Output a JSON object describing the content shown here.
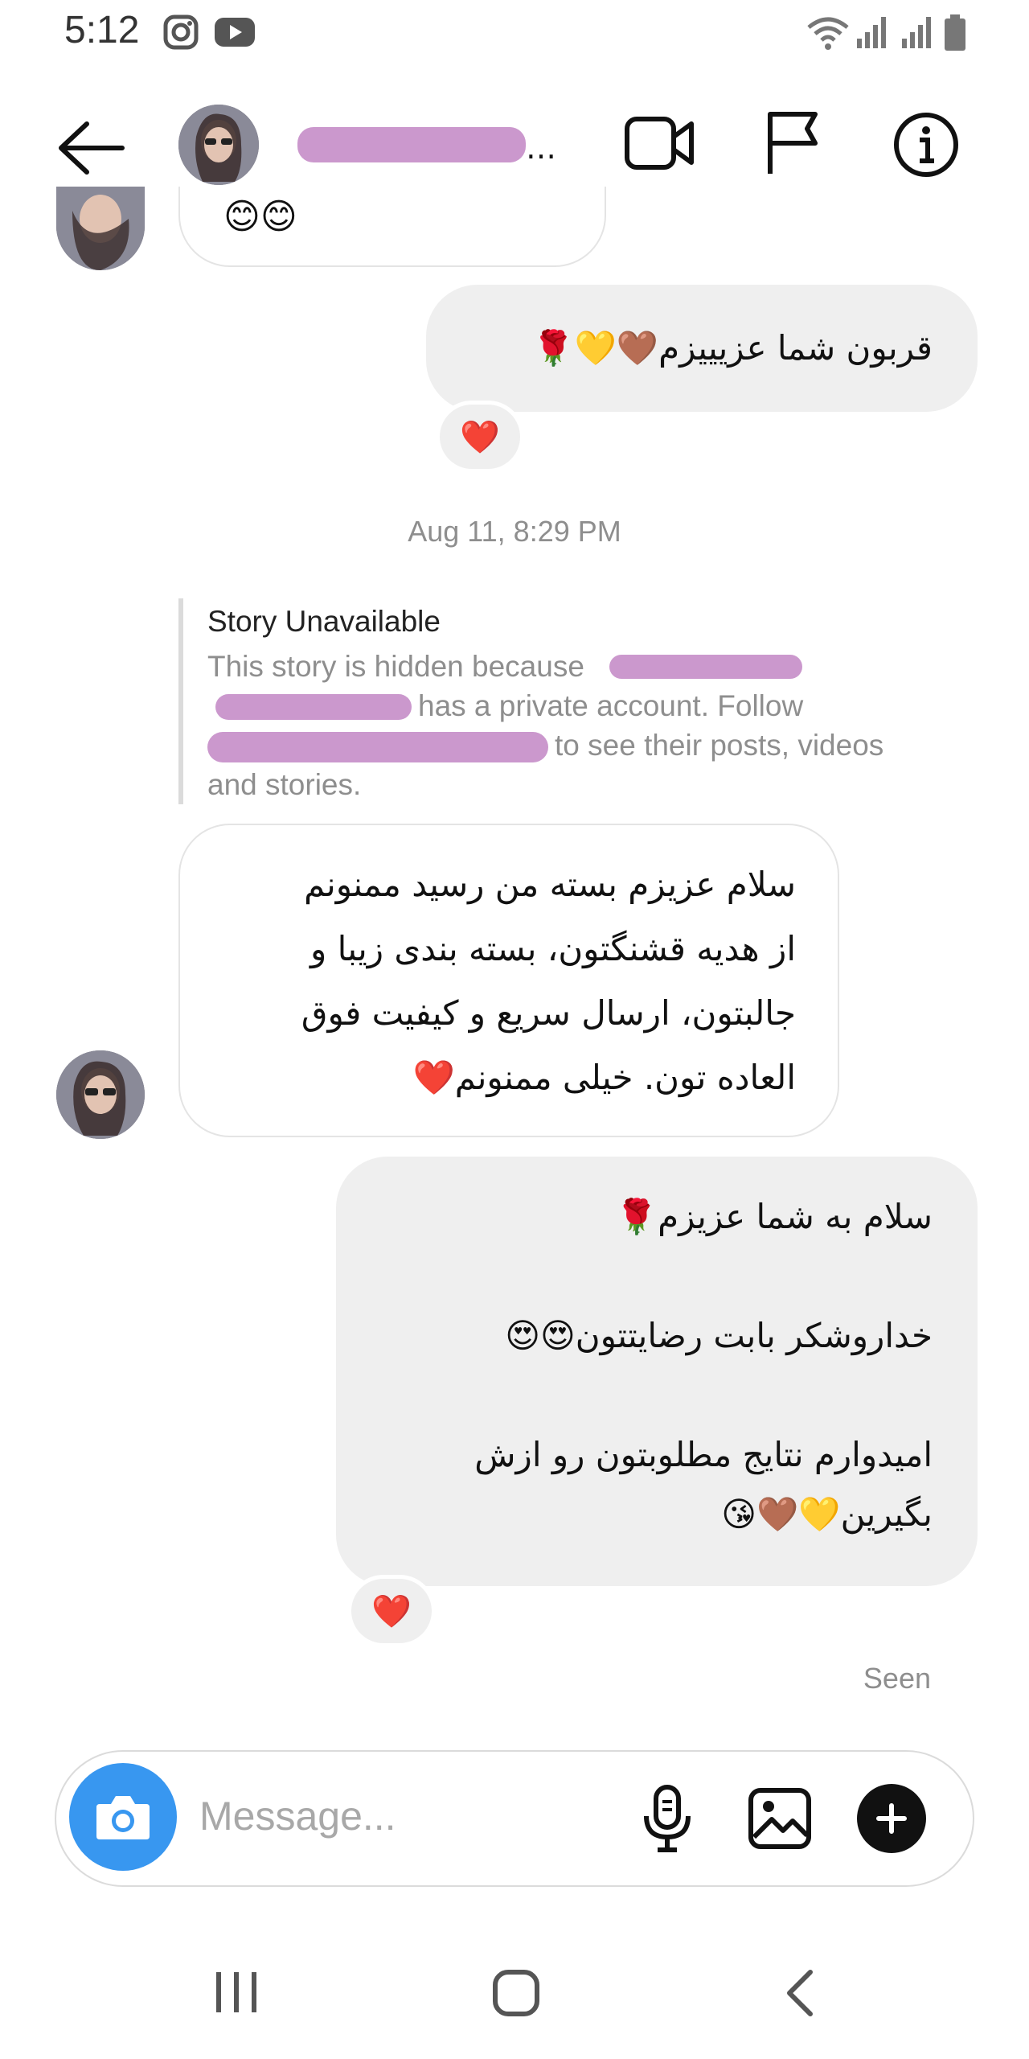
{
  "status_bar": {
    "time": "5:12",
    "icons": [
      "instagram-icon",
      "youtube-icon",
      "wifi-icon",
      "signal-icon",
      "signal-icon",
      "battery-icon"
    ]
  },
  "header": {
    "username": "…",
    "icons": [
      "back-arrow-icon",
      "video-camera-icon",
      "flag-icon",
      "info-icon"
    ]
  },
  "messages": [
    {
      "id": "m1",
      "side": "received",
      "text": "😊😊",
      "partial": true
    },
    {
      "id": "m2",
      "side": "sent",
      "text": "قربون شما عزیییزم🤎💛🌹",
      "reaction": "❤️"
    },
    {
      "id": "ts",
      "timestamp": "Aug 11, 8:29 PM"
    },
    {
      "id": "story",
      "title": "Story Unavailable",
      "body_1": "This story is hidden because",
      "body_2": "has a private account. Follow",
      "body_3": "to see their posts, videos",
      "body_4": "and stories."
    },
    {
      "id": "m3",
      "side": "received",
      "text": "سلام عزیزم بسته من رسید ممنونم\nاز هدیه قشنگتون، بسته بندی زیبا و\nجالبتون، ارسال سریع و کیفیت فوق\nالعاده تون. خیلی ممنونم❤️"
    },
    {
      "id": "m4",
      "side": "sent",
      "text": "سلام به شما عزیزم🌹\n\nخداروشکر بابت رضایتتون😍😍\n\nامیدوارم نتایج مطلوبتون رو ازش\nبگیرین💛🤎😘",
      "reaction": "❤️"
    }
  ],
  "seen": "Seen",
  "composer": {
    "placeholder": "Message...",
    "icons": [
      "camera-icon",
      "microphone-icon",
      "gallery-icon",
      "plus-icon"
    ]
  },
  "nav_bar": {
    "icons": [
      "recents-icon",
      "home-icon",
      "back-icon"
    ]
  },
  "colors": {
    "accent": "#3897f0",
    "sent_bubble": "#efefef",
    "redaction": "#c78fc9",
    "heart": "#ed2a3a"
  }
}
